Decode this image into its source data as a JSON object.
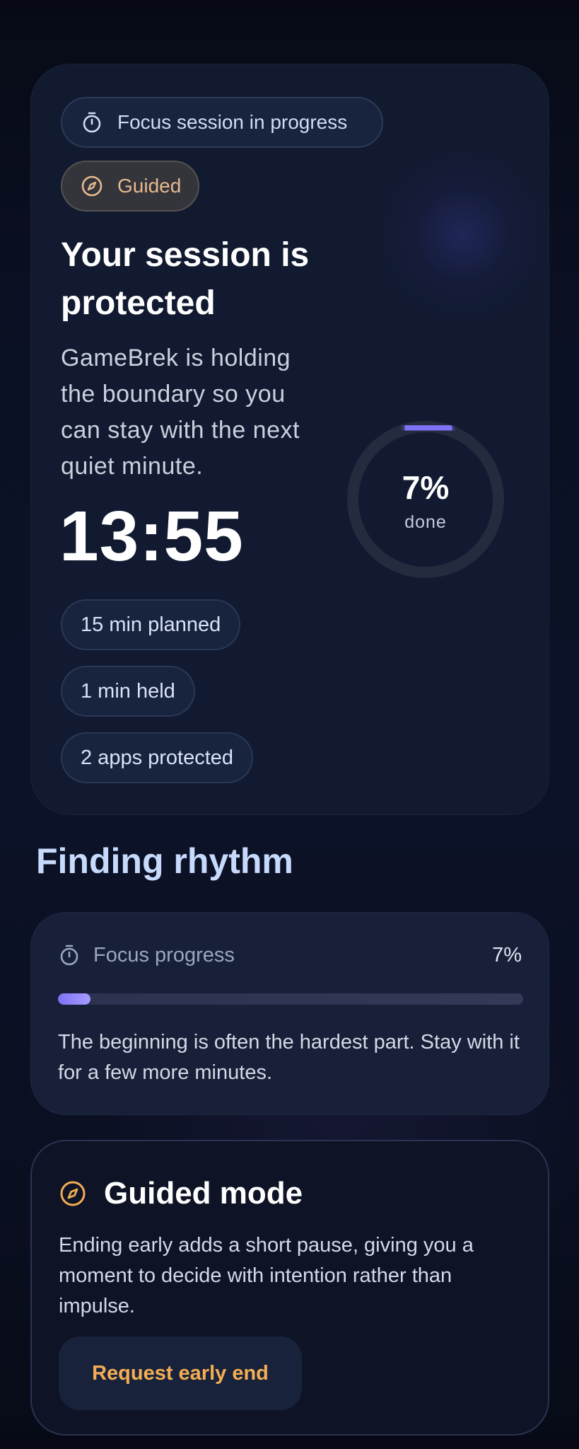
{
  "colors": {
    "accent": "#8b7ff7",
    "mode_amber": "#f3ad55",
    "background": "#0a0e1c",
    "card": "#111a30"
  },
  "hero": {
    "status_icon": "stopwatch-icon",
    "status_label": "Focus session in progress",
    "mode_icon": "compass-icon",
    "mode_label": "Guided",
    "title": "Your session is protected",
    "description": "GameBrek is holding the boundary so you can stay with the next quiet minute.",
    "timer": "13:55",
    "chips": [
      "15 min planned",
      "1 min held",
      "2 apps protected"
    ],
    "ring": {
      "value_label": "7%",
      "caption": "done",
      "fraction": 0.07
    }
  },
  "rhythm": {
    "section_title": "Finding rhythm",
    "progress_icon": "stopwatch-icon",
    "progress_label": "Focus progress",
    "progress_value": "7%",
    "progress_fraction": 0.07,
    "message": "The beginning is often the hardest part. Stay with it for a few more minutes."
  },
  "guided": {
    "icon": "compass-icon",
    "title": "Guided mode",
    "text": "Ending early adds a short pause, giving you a moment to decide with intention rather than impulse.",
    "button_label": "Request early end"
  }
}
